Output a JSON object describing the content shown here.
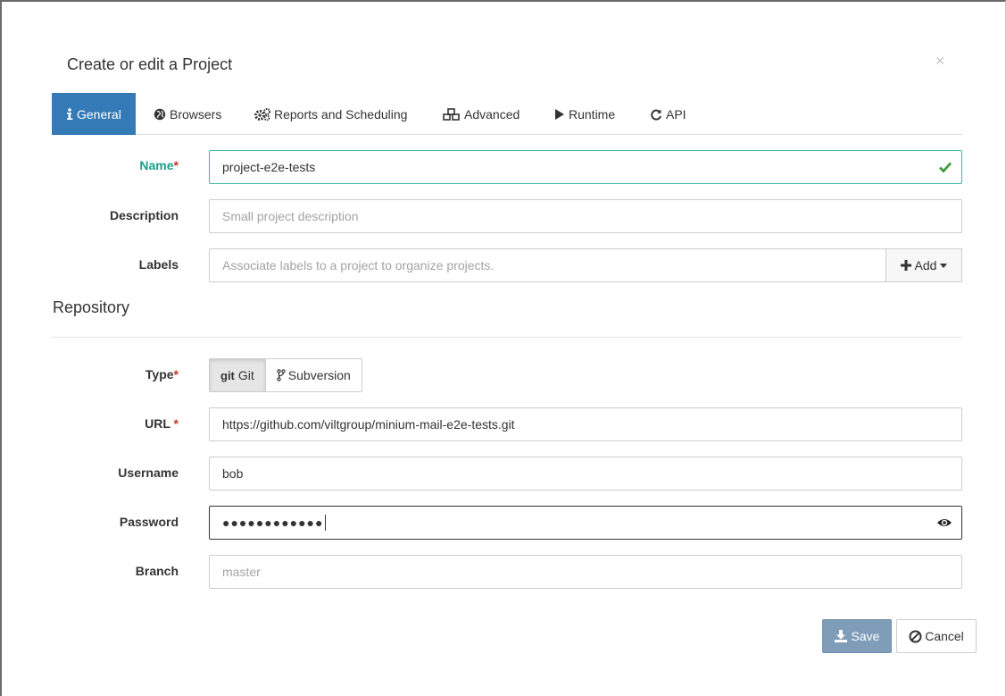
{
  "dialog": {
    "title": "Create or edit a Project",
    "close_label": "×"
  },
  "tabs": [
    {
      "label": "General",
      "icon": "info-icon",
      "active": true
    },
    {
      "label": "Browsers",
      "icon": "globe-icon"
    },
    {
      "label": "Reports and Scheduling",
      "icon": "gears-icon"
    },
    {
      "label": "Advanced",
      "icon": "cubes-icon"
    },
    {
      "label": "Runtime",
      "icon": "play-icon"
    },
    {
      "label": "API",
      "icon": "refresh-icon"
    }
  ],
  "general": {
    "name": {
      "label": "Name",
      "required_mark": "*",
      "value": "project-e2e-tests"
    },
    "description": {
      "label": "Description",
      "placeholder": "Small project description"
    },
    "labels": {
      "label": "Labels",
      "placeholder": "Associate labels to a project to organize projects.",
      "add_label": "Add"
    }
  },
  "repository": {
    "section_title": "Repository",
    "type": {
      "label": "Type",
      "required_mark": "*",
      "options": [
        {
          "icon_text": "git",
          "label": "Git",
          "active": true
        },
        {
          "label": "Subversion"
        }
      ]
    },
    "url": {
      "label": "URL",
      "required_mark": "*",
      "value": "https://github.com/viltgroup/minium-mail-e2e-tests.git"
    },
    "username": {
      "label": "Username",
      "value": "bob"
    },
    "password": {
      "label": "Password",
      "value": "●●●●●●●●●●●●"
    },
    "branch": {
      "label": "Branch",
      "placeholder": "master"
    }
  },
  "footer": {
    "save_label": "Save",
    "cancel_label": "Cancel"
  },
  "colors": {
    "primary": "#337ab7",
    "valid": "#1b9e8a",
    "required": "#c0392b",
    "save_disabled": "#7f9db8"
  }
}
